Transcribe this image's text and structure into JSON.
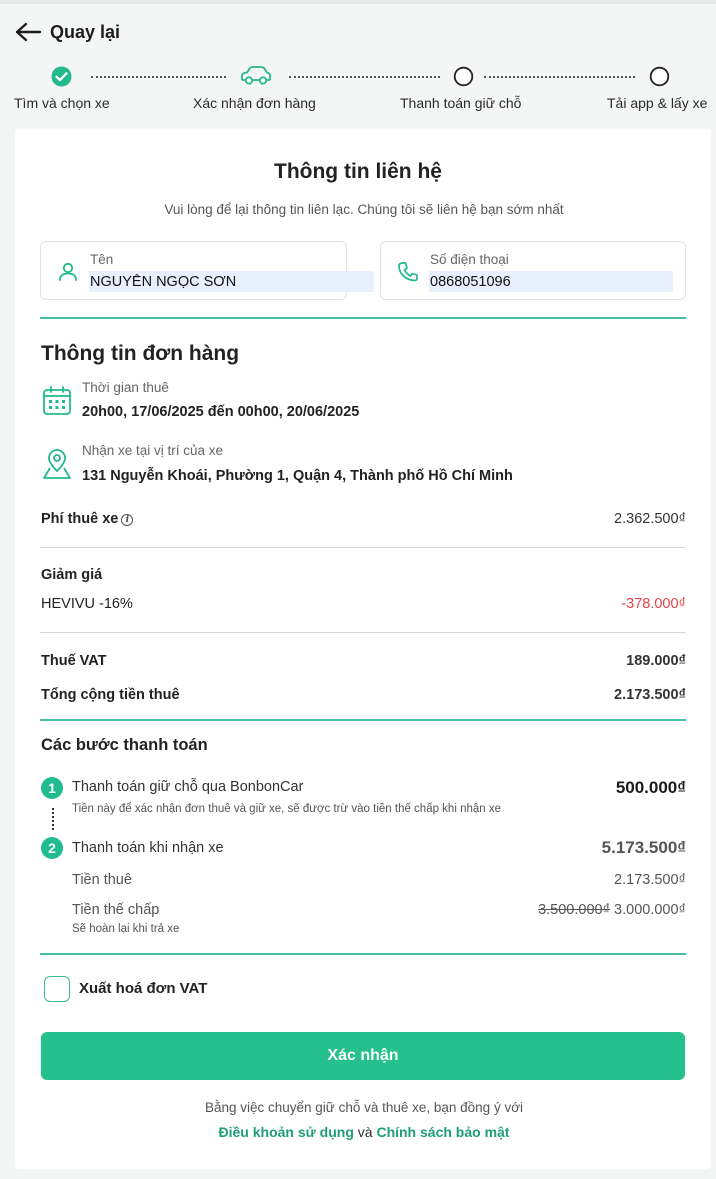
{
  "header": {
    "back_label": "Quay lại"
  },
  "stepper": {
    "steps": [
      {
        "label": "Tìm và chọn xe",
        "state": "done"
      },
      {
        "label": "Xác nhận đơn hàng",
        "state": "current"
      },
      {
        "label": "Thanh toán giữ chỗ",
        "state": "pending"
      },
      {
        "label": "Tải app & lấy xe",
        "state": "pending"
      }
    ]
  },
  "contact": {
    "title": "Thông tin liên hệ",
    "subtitle": "Vui lòng để lại thông tin liên lạc. Chúng tôi sẽ liên hệ bạn sớm nhất",
    "name_label": "Tên",
    "name_value": "NGUYỄN NGỌC SƠN",
    "phone_label": "Số điện thoại",
    "phone_value": "0868051096"
  },
  "order": {
    "title": "Thông tin đơn hàng",
    "rental_time_label": "Thời gian thuê",
    "rental_time_value": "20h00, 17/06/2025 đến 00h00, 20/06/2025",
    "pickup_label": "Nhận xe tại vị trí của xe",
    "pickup_value": "131 Nguyễn Khoái, Phường 1, Quận 4, Thành phố Hồ Chí Minh",
    "rental_fee_label": "Phí thuê xe",
    "rental_fee_value": "2.362.500₫",
    "discount_label": "Giảm giá",
    "discount_code": "HEVIVU -16%",
    "discount_value": "-378.000₫",
    "vat_label": "Thuế VAT",
    "vat_value": "189.000₫",
    "total_label": "Tổng cộng tiền thuê",
    "total_value": "2.173.500₫"
  },
  "payment": {
    "title": "Các bước thanh toán",
    "step1_number": "1",
    "step1_label": "Thanh toán giữ chỗ qua BonbonCar",
    "step1_value": "500.000₫",
    "step1_note": "Tiền này để xác nhận đơn thuê và giữ xe, sẽ được trừ vào tiền thế chấp khi nhận xe",
    "step2_number": "2",
    "step2_label": "Thanh toán khi nhận xe",
    "step2_value": "5.173.500₫",
    "rent_label": "Tiền thuê",
    "rent_value": "2.173.500₫",
    "deposit_label": "Tiền thế chấp",
    "deposit_old_value": "3.500.000₫",
    "deposit_value": "3.000.000₫",
    "deposit_note": "Sẽ hoàn lại khi trả xe"
  },
  "vat_invoice": {
    "label": "Xuất hoá đơn VAT",
    "checked": false
  },
  "confirm": {
    "label": "Xác nhận"
  },
  "footer": {
    "agree_text": "Bằng việc chuyển giữ chỗ và thuê xe, bạn đồng ý với",
    "terms_link": "Điều khoản sử dụng",
    "and_text": "và",
    "privacy_link": "Chính sách bảo mật"
  },
  "colors": {
    "accent": "#25c08d",
    "accent_line": "#45bfa5",
    "negative": "#e0454b"
  },
  "icons": [
    "back-arrow-icon",
    "check-circle-icon",
    "car-icon",
    "empty-circle-icon",
    "user-icon",
    "phone-icon",
    "calendar-icon",
    "map-pin-icon",
    "info-icon"
  ]
}
